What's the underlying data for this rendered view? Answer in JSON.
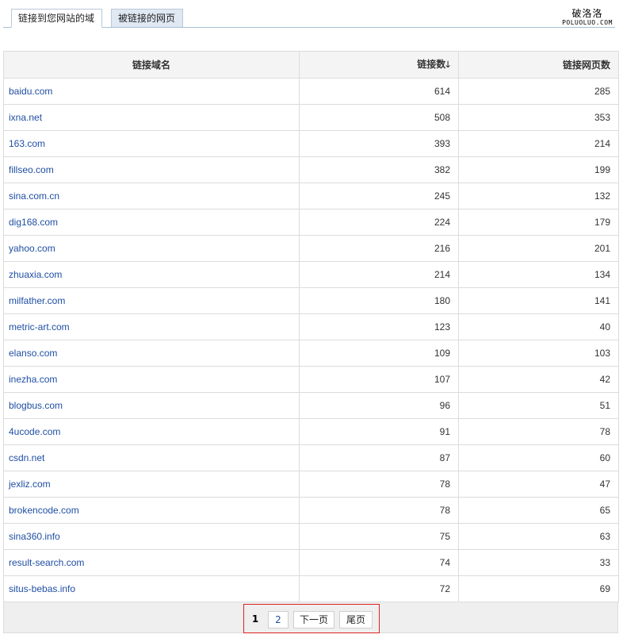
{
  "tabs": [
    {
      "label": "链接到您网站的域",
      "active": true
    },
    {
      "label": "被链接的网页",
      "active": false
    }
  ],
  "logo": {
    "cn": "破洛洛",
    "en": "POLUOLUO.COM"
  },
  "table": {
    "headers": {
      "domain": "链接域名",
      "links": "链接数",
      "pages": "链接网页数",
      "sort_indicator": "down-arrow-icon"
    },
    "rows": [
      {
        "domain": "baidu.com",
        "links": "614",
        "pages": "285"
      },
      {
        "domain": "ixna.net",
        "links": "508",
        "pages": "353"
      },
      {
        "domain": "163.com",
        "links": "393",
        "pages": "214"
      },
      {
        "domain": "fillseo.com",
        "links": "382",
        "pages": "199"
      },
      {
        "domain": "sina.com.cn",
        "links": "245",
        "pages": "132"
      },
      {
        "domain": "dig168.com",
        "links": "224",
        "pages": "179"
      },
      {
        "domain": "yahoo.com",
        "links": "216",
        "pages": "201"
      },
      {
        "domain": "zhuaxia.com",
        "links": "214",
        "pages": "134"
      },
      {
        "domain": "milfather.com",
        "links": "180",
        "pages": "141"
      },
      {
        "domain": "metric-art.com",
        "links": "123",
        "pages": "40"
      },
      {
        "domain": "elanso.com",
        "links": "109",
        "pages": "103"
      },
      {
        "domain": "inezha.com",
        "links": "107",
        "pages": "42"
      },
      {
        "domain": "blogbus.com",
        "links": "96",
        "pages": "51"
      },
      {
        "domain": "4ucode.com",
        "links": "91",
        "pages": "78"
      },
      {
        "domain": "csdn.net",
        "links": "87",
        "pages": "60"
      },
      {
        "domain": "jexliz.com",
        "links": "78",
        "pages": "47"
      },
      {
        "domain": "brokencode.com",
        "links": "78",
        "pages": "65"
      },
      {
        "domain": "sina360.info",
        "links": "75",
        "pages": "63"
      },
      {
        "domain": "result-search.com",
        "links": "74",
        "pages": "33"
      },
      {
        "domain": "situs-bebas.info",
        "links": "72",
        "pages": "69"
      }
    ]
  },
  "pager": {
    "current": "1",
    "page2": "2",
    "next": "下一页",
    "last": "尾页"
  },
  "colors": {
    "link": "#1f4fa3",
    "highlight_border": "#d22222",
    "tab_inactive_bg": "#dfe8f3"
  }
}
